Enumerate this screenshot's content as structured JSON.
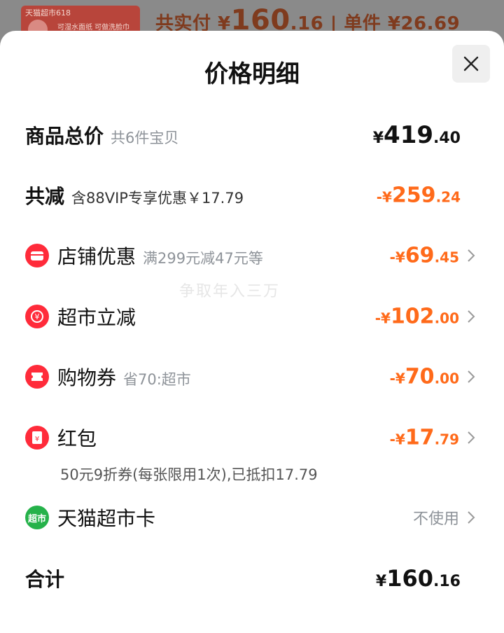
{
  "background": {
    "product_tag": "天猫超市618",
    "product_desc": "可湿水面纸 可做洗脸巾",
    "price_prefix": "共实付 ¥",
    "price_int": "160",
    "price_dec": ".16",
    "unit_text": " | 单件 ¥26.69"
  },
  "sheet": {
    "title": "价格明细",
    "close_icon": "close-icon"
  },
  "watermark": "争取年入三万",
  "rows": {
    "goods_total": {
      "label": "商品总价",
      "sub": "共6件宝贝",
      "cur": "¥",
      "int": "419",
      "dec": ".40"
    },
    "total_reduce": {
      "label": "共减",
      "sub": "含88VIP专享优惠￥17.79",
      "cur": "-¥",
      "int": "259",
      "dec": ".24"
    },
    "shop_discount": {
      "label": "店铺优惠",
      "sub": "满299元减47元等",
      "cur": "-¥",
      "int": "69",
      "dec": ".45",
      "icon": "shop-icon"
    },
    "market_reduce": {
      "label": "超市立减",
      "sub": "",
      "cur": "-¥",
      "int": "102",
      "dec": ".00",
      "icon": "discount-icon"
    },
    "coupon": {
      "label": "购物券",
      "sub": "省70:超市",
      "cur": "-¥",
      "int": "70",
      "dec": ".00",
      "icon": "ticket-icon"
    },
    "red_packet": {
      "label": "红包",
      "sub": "",
      "cur": "-¥",
      "int": "17",
      "dec": ".79",
      "icon": "red-packet-icon",
      "note": "50元9折券(每张限用1次),已抵扣17.79"
    },
    "tmall_card": {
      "label": "天猫超市卡",
      "icon": "tmall-market-icon",
      "icon_text": "超市",
      "status": "不使用"
    },
    "grand_total": {
      "label": "合计",
      "cur": "¥",
      "int": "160",
      "dec": ".16"
    }
  },
  "colors": {
    "accent": "#ff6a1a",
    "icon_red": "#ff2b3a",
    "icon_green": "#25b24a"
  }
}
